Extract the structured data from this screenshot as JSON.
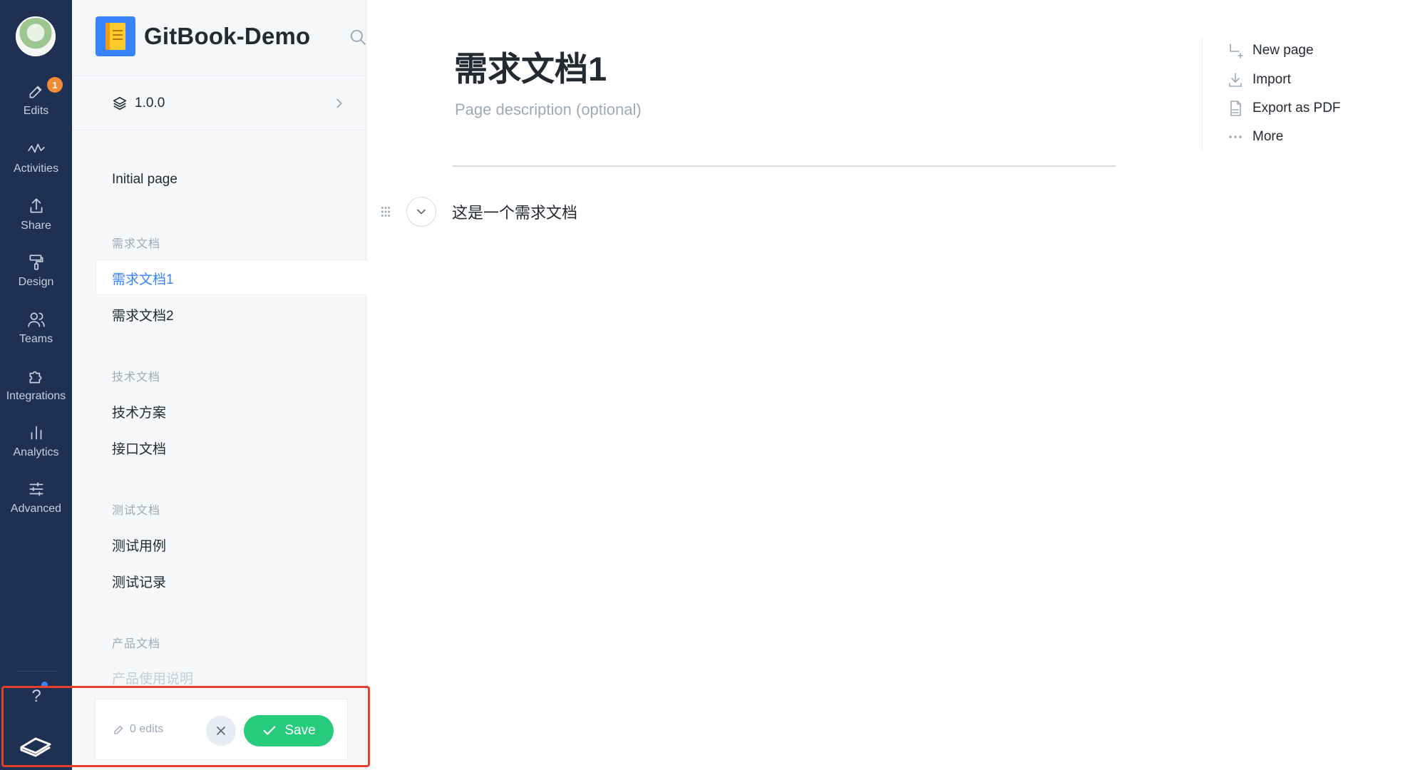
{
  "rail": {
    "badge_count": "1",
    "items": [
      {
        "label": "Edits",
        "icon": "pencil-icon"
      },
      {
        "label": "Activities",
        "icon": "activity-icon"
      },
      {
        "label": "Share",
        "icon": "share-icon"
      },
      {
        "label": "Design",
        "icon": "paint-roller-icon"
      },
      {
        "label": "Teams",
        "icon": "users-icon"
      },
      {
        "label": "Integrations",
        "icon": "puzzle-icon"
      },
      {
        "label": "Analytics",
        "icon": "bar-chart-icon"
      },
      {
        "label": "Advanced",
        "icon": "sliders-icon"
      }
    ],
    "help_label": "?"
  },
  "sidebar": {
    "space_title": "GitBook-Demo",
    "version": "1.0.0",
    "pages": {
      "initial": "Initial page",
      "group1": "需求文档",
      "item1": "需求文档1",
      "item2": "需求文档2",
      "group2": "技术文档",
      "item3": "技术方案",
      "item4": "接口文档",
      "group3": "测试文档",
      "item5": "测试用例",
      "item6": "测试记录",
      "group4": "产品文档",
      "item7": "产品使用说明"
    }
  },
  "editbar": {
    "edits_label": "0 edits",
    "save_label": "Save"
  },
  "main": {
    "title": "需求文档1",
    "description_placeholder": "Page description (optional)",
    "body_text": "这是一个需求文档"
  },
  "actions": {
    "new_page": "New page",
    "import": "Import",
    "export_pdf": "Export as PDF",
    "more": "More"
  },
  "colors": {
    "rail_bg": "#1f3152",
    "accent": "#3884ff",
    "save_green": "#26cb7c",
    "highlight_red": "#e53e2b"
  }
}
